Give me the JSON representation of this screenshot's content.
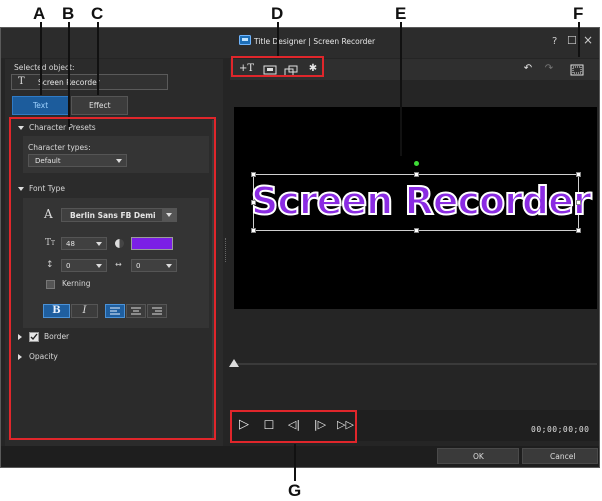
{
  "callouts": {
    "a": "A",
    "b": "B",
    "c": "C",
    "d": "D",
    "e": "E",
    "f": "F",
    "g": "G"
  },
  "window": {
    "title": "Title Designer | Screen Recorder",
    "help": "?",
    "maximize": "☐",
    "close": "×"
  },
  "selected_object": {
    "label": "Selected object:",
    "glyph": "T",
    "value": "Screen Recorder"
  },
  "tabs": {
    "text": "Text",
    "effect": "Effect"
  },
  "character_presets": {
    "header": "Character Presets",
    "types_label": "Character types:",
    "types_value": "Default"
  },
  "font_type": {
    "header": "Font Type",
    "font_glyph": "A",
    "font_name": "Berlin Sans FB Demi",
    "size": "48",
    "color": "#7b1fe6",
    "line_spacing": "0",
    "char_spacing": "0",
    "kerning_label": "Kerning",
    "bold": "B",
    "italic": "I"
  },
  "border": {
    "label": "Border"
  },
  "opacity": {
    "label": "Opacity"
  },
  "preview": {
    "text": "Screen Recorder"
  },
  "timecode": "00;00;00;00",
  "buttons": {
    "ok": "OK",
    "cancel": "Cancel"
  }
}
